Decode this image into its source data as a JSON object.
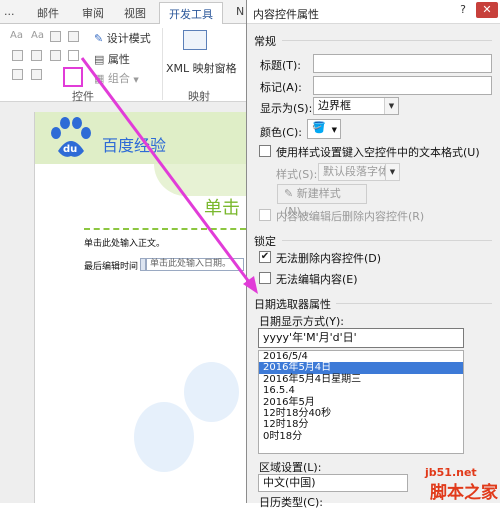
{
  "ribbon": {
    "tabs": [
      "邮件",
      "审阅",
      "视图",
      "开发工具",
      "N"
    ],
    "active_tab": "开发工具",
    "controls_group": {
      "design_mode": "设计模式",
      "properties": "属性",
      "group": "组合",
      "label": "控件"
    },
    "mapping_group": {
      "xml_pane": "XML 映射窗格",
      "label": "映射"
    }
  },
  "document": {
    "logo_text": "百度经验",
    "title_fragment": "单击",
    "line1": "单击此处输入正文。",
    "line2_label": "最后编辑时间",
    "date_placeholder": "单击此处输入日期。"
  },
  "dialog": {
    "title": "内容控件属性",
    "help": "?",
    "close": "✕",
    "general": {
      "section": "常规",
      "title_label": "标题(T):",
      "title_value": "",
      "tag_label": "标记(A):",
      "tag_value": "",
      "show_as_label": "显示为(S):",
      "show_as_value": "边界框",
      "color_label": "颜色(C):",
      "use_style_label": "使用样式设置键入空控件中的文本格式(U)",
      "use_style_checked": false,
      "style_label": "样式(S):",
      "style_value": "默认段落字体",
      "new_style_button": "新建样式(N)...",
      "remove_label": "内容被编辑后删除内容控件(R)",
      "remove_checked": false
    },
    "locking": {
      "section": "锁定",
      "no_delete_label": "无法删除内容控件(D)",
      "no_delete_checked": true,
      "no_edit_label": "无法编辑内容(E)",
      "no_edit_checked": false
    },
    "date_picker": {
      "section": "日期选取器属性",
      "format_label": "日期显示方式(Y):",
      "format_value": "yyyy'年'M'月'd'日'",
      "formats": [
        "2016/5/4",
        "2016年5月4日",
        "2016年5月4日星期三",
        "16.5.4",
        "2016年5月",
        "12时18分40秒",
        "12时18分",
        "0时18分"
      ],
      "selected_format": "2016年5月4日",
      "locale_label": "区域设置(L):",
      "locale_value": "中文(中国)",
      "calendar_label": "日历类型(C):"
    }
  },
  "watermark": {
    "site": "jb51.net",
    "name": "脚本之家"
  },
  "colors": {
    "highlight": "#e13cd8",
    "selection": "#3d7ad7",
    "close_button": "#c7403b",
    "baidu_blue": "#2e6bd6",
    "title_green": "#7ab82e",
    "watermark_red": "#e13a1a"
  }
}
